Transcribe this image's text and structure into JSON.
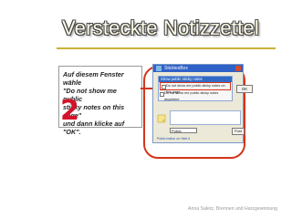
{
  "slide": {
    "title": "Versteckte Notizzettel",
    "callout_lines": [
      "Auf diesem Fenster wähle",
      "\"Do not show me public",
      "sticky notes on this page\"",
      "und dann klicke auf",
      "\"OK\"."
    ],
    "step_number": "2",
    "footer": "Anna Saletz, Brennen und Harzgewinnung"
  },
  "dialog": {
    "title": "StickiesBox",
    "panel_heading": "Show public sticky notes",
    "option_1": "Do not show me public sticky notes on this page",
    "option_2": "Do not show me public sticky notes anywhere",
    "ok_label": "OK",
    "select_value": "Public",
    "post_label": "Post",
    "link": "Public button on  Hide it"
  },
  "colors": {
    "accent": "#d2351c",
    "title_stroke": "#444444",
    "number": "#d4122a",
    "dialog_title": "#2f62c7"
  }
}
